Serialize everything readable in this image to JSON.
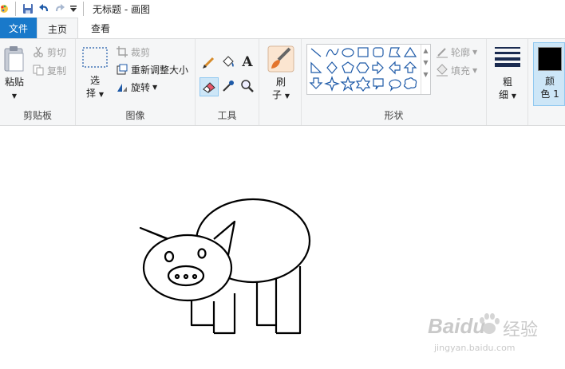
{
  "titlebar": {
    "title": "无标题 - 画图"
  },
  "tabs": {
    "file": "文件",
    "home": "主页",
    "view": "查看"
  },
  "clipboard": {
    "paste": "粘贴",
    "cut": "剪切",
    "copy": "复制",
    "group": "剪贴板"
  },
  "image": {
    "select_line1": "选",
    "select_line2": "择",
    "crop": "裁剪",
    "resize": "重新调整大小",
    "rotate": "旋转",
    "group": "图像"
  },
  "tools": {
    "group": "工具"
  },
  "brushes": {
    "label_line1": "刷",
    "label_line2": "子"
  },
  "shapes": {
    "outline": "轮廓",
    "fill": "填充",
    "group": "形状"
  },
  "size": {
    "label_line1": "粗",
    "label_line2": "细"
  },
  "color1": {
    "label_line1": "颜",
    "label_line2": "色 1",
    "color": "#000000"
  },
  "watermark": {
    "brand": "Baidu",
    "brand_cn": "经验",
    "url": "jingyan.baidu.com"
  },
  "colors": {
    "file_tab": "#1979ca",
    "ribbon_bg": "#f5f6f7",
    "selected": "#cde6f7",
    "icon_blue": "#1e5aa8"
  }
}
